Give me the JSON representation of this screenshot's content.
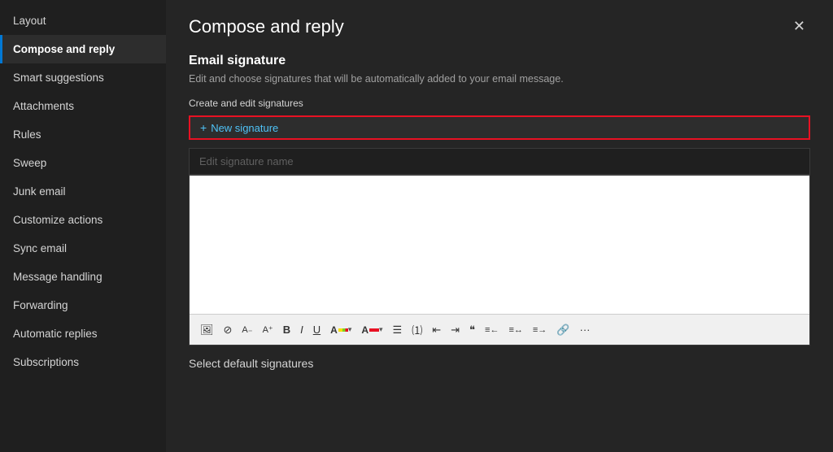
{
  "sidebar": {
    "items": [
      {
        "id": "layout",
        "label": "Layout",
        "active": false
      },
      {
        "id": "compose-and-reply",
        "label": "Compose and reply",
        "active": true
      },
      {
        "id": "smart-suggestions",
        "label": "Smart suggestions",
        "active": false
      },
      {
        "id": "attachments",
        "label": "Attachments",
        "active": false
      },
      {
        "id": "rules",
        "label": "Rules",
        "active": false
      },
      {
        "id": "sweep",
        "label": "Sweep",
        "active": false
      },
      {
        "id": "junk-email",
        "label": "Junk email",
        "active": false
      },
      {
        "id": "customize-actions",
        "label": "Customize actions",
        "active": false
      },
      {
        "id": "sync-email",
        "label": "Sync email",
        "active": false
      },
      {
        "id": "message-handling",
        "label": "Message handling",
        "active": false
      },
      {
        "id": "forwarding",
        "label": "Forwarding",
        "active": false
      },
      {
        "id": "automatic-replies",
        "label": "Automatic replies",
        "active": false
      },
      {
        "id": "subscriptions",
        "label": "Subscriptions",
        "active": false
      }
    ]
  },
  "main": {
    "page_title": "Compose and reply",
    "close_label": "✕",
    "email_sig_title": "Email signature",
    "email_sig_desc": "Edit and choose signatures that will be automatically added to your email message.",
    "create_label": "Create and edit signatures",
    "new_sig_plus": "+",
    "new_sig_label": "New signature",
    "sig_name_placeholder": "Edit signature name",
    "editor_placeholder": "",
    "select_default_label": "Select default signatures",
    "toolbar_buttons": [
      {
        "id": "insert-image",
        "icon": "🖼",
        "label": "Insert image"
      },
      {
        "id": "clear-format",
        "icon": "⌦",
        "label": "Clear format"
      },
      {
        "id": "font-size-down",
        "icon": "A↓",
        "label": "Font size decrease"
      },
      {
        "id": "font-size-up",
        "icon": "A↑",
        "label": "Font size increase"
      },
      {
        "id": "bold",
        "icon": "B",
        "label": "Bold"
      },
      {
        "id": "italic",
        "icon": "I",
        "label": "Italic"
      },
      {
        "id": "underline",
        "icon": "U",
        "label": "Underline"
      },
      {
        "id": "highlight",
        "icon": "Hl",
        "label": "Highlight"
      },
      {
        "id": "font-color",
        "icon": "Fc",
        "label": "Font color"
      },
      {
        "id": "bullets",
        "icon": "≡",
        "label": "Bullets"
      },
      {
        "id": "numbering",
        "icon": "1.",
        "label": "Numbering"
      },
      {
        "id": "decrease-indent",
        "icon": "◁≡",
        "label": "Decrease indent"
      },
      {
        "id": "increase-indent",
        "icon": "▷≡",
        "label": "Increase indent"
      },
      {
        "id": "quote",
        "icon": "❝",
        "label": "Quote"
      },
      {
        "id": "align-left",
        "icon": "⬅≡",
        "label": "Align left"
      },
      {
        "id": "align-center",
        "icon": "≡",
        "label": "Align center"
      },
      {
        "id": "align-right",
        "icon": "➡≡",
        "label": "Align right"
      },
      {
        "id": "link",
        "icon": "🔗",
        "label": "Link"
      },
      {
        "id": "more",
        "icon": "···",
        "label": "More options"
      }
    ]
  }
}
